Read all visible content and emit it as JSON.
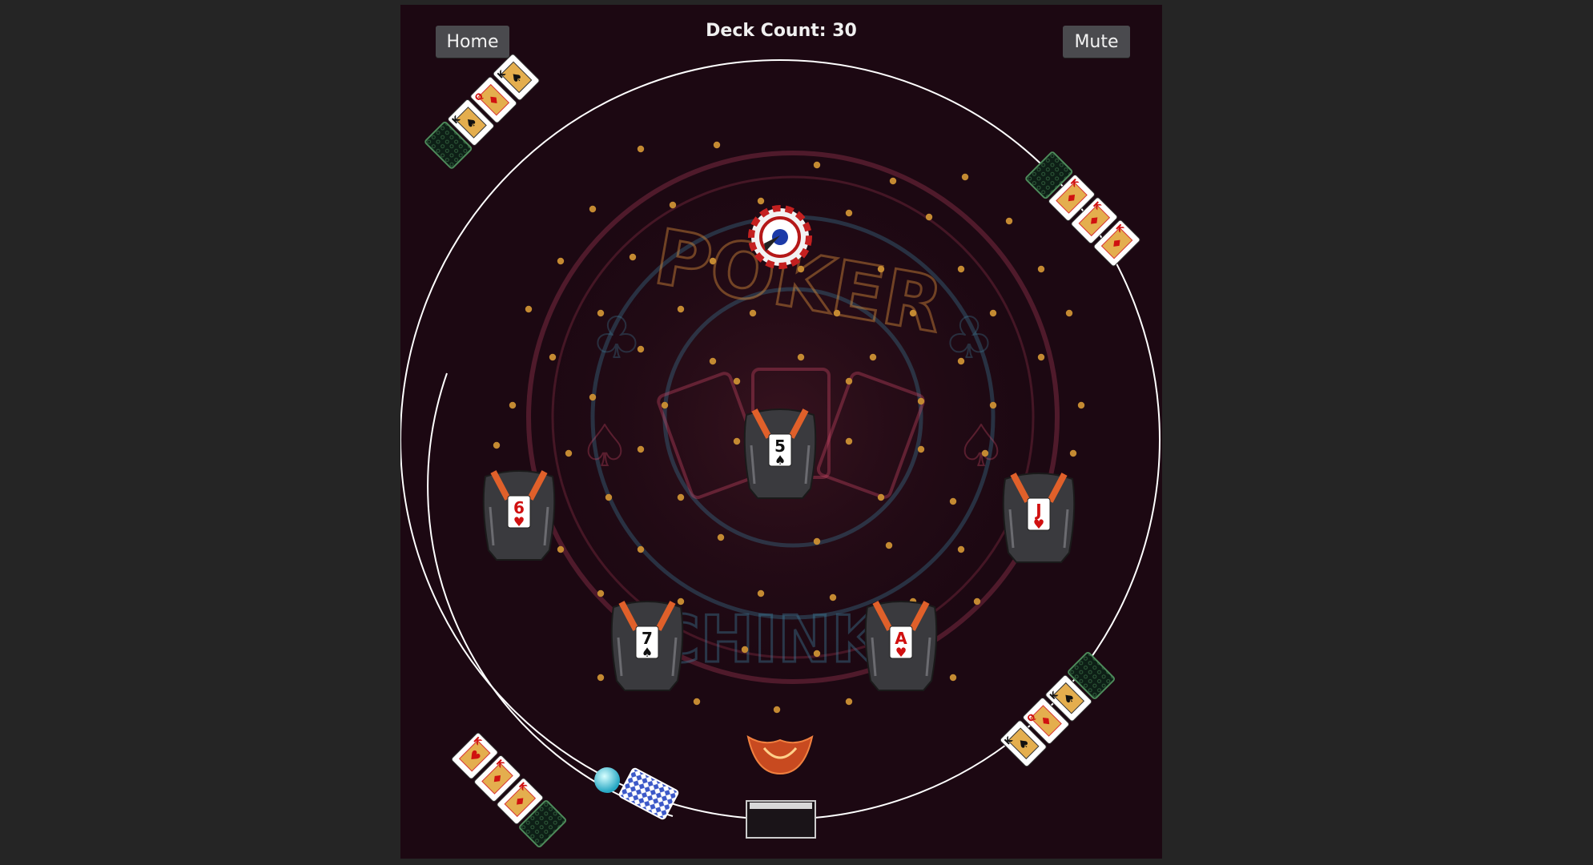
{
  "header": {
    "home_label": "Home",
    "mute_label": "Mute",
    "deck_count": "Deck Count: 30"
  },
  "logo": {
    "top_text": "POKER",
    "bottom_text": "CHINKO"
  },
  "buckets": [
    {
      "rank": "5",
      "suit": "♠",
      "color": "#111111"
    },
    {
      "rank": "6",
      "suit": "♥",
      "color": "#d01010"
    },
    {
      "rank": "J",
      "suit": "♥",
      "color": "#d01010"
    },
    {
      "rank": "7",
      "suit": "♠",
      "color": "#111111"
    },
    {
      "rank": "A",
      "suit": "♥",
      "color": "#d01010"
    }
  ],
  "hands": [
    {
      "position": "top-left",
      "ranks": [
        "K",
        "Q",
        "K"
      ],
      "suits": [
        "♠",
        "♦",
        "♠"
      ]
    },
    {
      "position": "top-right",
      "ranks": [
        "K",
        "K",
        "K"
      ],
      "suits": [
        "♦",
        "♦",
        "♦"
      ]
    },
    {
      "position": "bottom-left",
      "ranks": [
        "K",
        "K",
        "K"
      ],
      "suits": [
        "♥",
        "♦",
        "♦"
      ]
    },
    {
      "position": "bottom-right",
      "ranks": [
        "K",
        "Q",
        "K"
      ],
      "suits": [
        "♠",
        "♦",
        "♠"
      ]
    }
  ],
  "colors": {
    "background": "#1c0812",
    "page": "#252525",
    "ring": "#ffffff",
    "ball": "#4fd6ea",
    "peg": "#c48a32",
    "neon_pink": "#d44a6a",
    "neon_blue": "#3d7e9a",
    "neon_orange": "#d48a3a"
  }
}
